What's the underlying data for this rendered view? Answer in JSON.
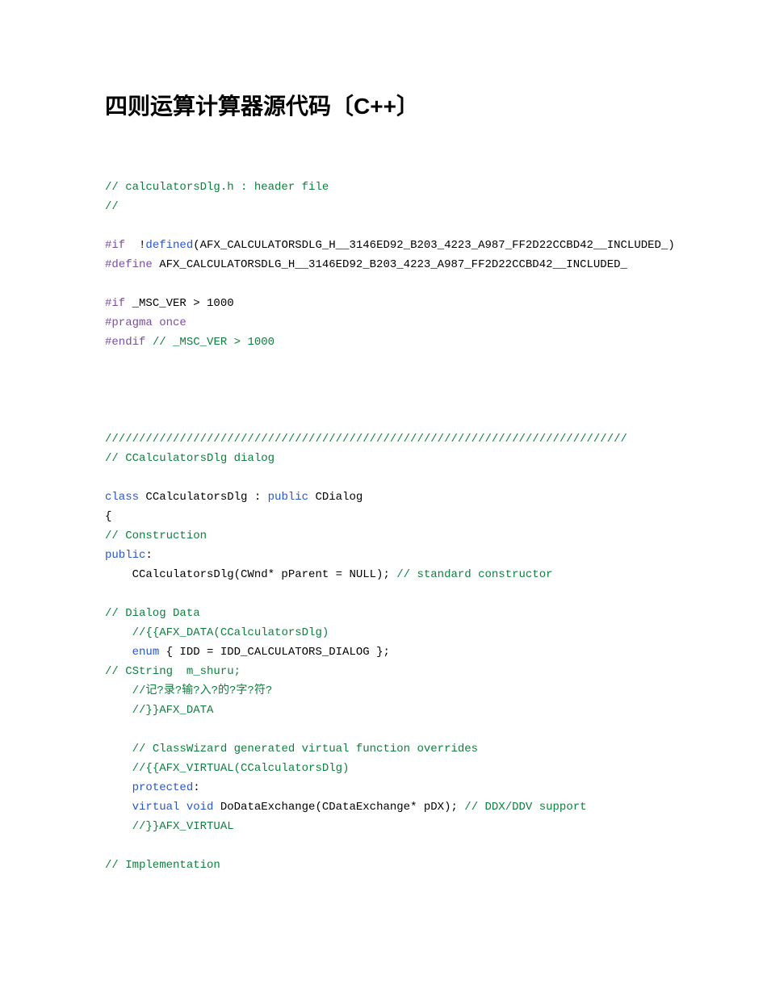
{
  "title": "四则运算计算器源代码〔C++〕",
  "tokens": [
    {
      "cls": "c",
      "txt": "// calculatorsDlg.h : header file"
    },
    {
      "br": 1
    },
    {
      "cls": "c",
      "txt": "//"
    },
    {
      "br": 2
    },
    {
      "cls": "pk",
      "txt": "#if "
    },
    {
      "txt": " !"
    },
    {
      "cls": "k",
      "txt": "defined"
    },
    {
      "txt": "(AFX_CALCULATORSDLG_H__3146ED92_B203_4223_A987_FF2D22CCBD42__INCLUDED_)"
    },
    {
      "br": 1
    },
    {
      "cls": "pk",
      "txt": "#define"
    },
    {
      "txt": " AFX_CALCULATORSDLG_H__3146ED92_B203_4223_A987_FF2D22CCBD42__INCLUDED_"
    },
    {
      "br": 2
    },
    {
      "cls": "pk",
      "txt": "#if"
    },
    {
      "txt": " _MSC_VER > 1000"
    },
    {
      "br": 1
    },
    {
      "cls": "pk",
      "txt": "#pragma once"
    },
    {
      "br": 1
    },
    {
      "cls": "pk",
      "txt": "#endif"
    },
    {
      "txt": " "
    },
    {
      "cls": "c",
      "txt": "// _MSC_VER > 1000"
    },
    {
      "br": 5
    },
    {
      "cls": "c",
      "txt": "/////////////////////////////////////////////////////////////////////////////"
    },
    {
      "br": 1
    },
    {
      "cls": "c",
      "txt": "// CCalculatorsDlg dialog"
    },
    {
      "br": 2
    },
    {
      "cls": "k",
      "txt": "class"
    },
    {
      "txt": " CCalculatorsDlg : "
    },
    {
      "cls": "k",
      "txt": "public"
    },
    {
      "txt": " CDialog"
    },
    {
      "br": 1
    },
    {
      "txt": "{"
    },
    {
      "br": 1
    },
    {
      "cls": "c",
      "txt": "// Construction"
    },
    {
      "br": 1
    },
    {
      "cls": "k",
      "txt": "public"
    },
    {
      "txt": ":"
    },
    {
      "br": 1
    },
    {
      "txt": "    CCalculatorsDlg(CWnd* pParent = NULL); "
    },
    {
      "cls": "c",
      "txt": "// standard constructor"
    },
    {
      "br": 2
    },
    {
      "cls": "c",
      "txt": "// Dialog Data"
    },
    {
      "br": 1
    },
    {
      "txt": "    "
    },
    {
      "cls": "c",
      "txt": "//{{AFX_DATA(CCalculatorsDlg)"
    },
    {
      "br": 1
    },
    {
      "txt": "    "
    },
    {
      "cls": "k",
      "txt": "enum"
    },
    {
      "txt": " { IDD = IDD_CALCULATORS_DIALOG };"
    },
    {
      "br": 1
    },
    {
      "cls": "c",
      "txt": "// CString  m_shuru;"
    },
    {
      "br": 1
    },
    {
      "txt": "    "
    },
    {
      "cls": "c",
      "txt": "//记?录?输?入?的?字?符?"
    },
    {
      "br": 1
    },
    {
      "txt": "    "
    },
    {
      "cls": "c",
      "txt": "//}}AFX_DATA"
    },
    {
      "br": 2
    },
    {
      "txt": "    "
    },
    {
      "cls": "c",
      "txt": "// ClassWizard generated virtual function overrides"
    },
    {
      "br": 1
    },
    {
      "txt": "    "
    },
    {
      "cls": "c",
      "txt": "//{{AFX_VIRTUAL(CCalculatorsDlg)"
    },
    {
      "br": 1
    },
    {
      "txt": "    "
    },
    {
      "cls": "k",
      "txt": "protected"
    },
    {
      "txt": ":"
    },
    {
      "br": 1
    },
    {
      "txt": "    "
    },
    {
      "cls": "k",
      "txt": "virtual"
    },
    {
      "txt": " "
    },
    {
      "cls": "k",
      "txt": "void"
    },
    {
      "txt": " DoDataExchange(CDataExchange* pDX); "
    },
    {
      "cls": "c",
      "txt": "// DDX/DDV support"
    },
    {
      "br": 1
    },
    {
      "txt": "    "
    },
    {
      "cls": "c",
      "txt": "//}}AFX_VIRTUAL"
    },
    {
      "br": 2
    },
    {
      "cls": "c",
      "txt": "// Implementation"
    }
  ]
}
